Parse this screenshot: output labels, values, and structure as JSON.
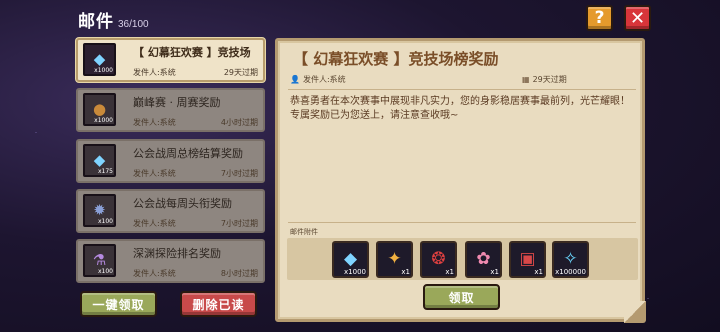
{
  "header": {
    "title": "邮件",
    "count": "36/100",
    "help_label": "?",
    "close_label": "✕"
  },
  "mail_list": [
    {
      "subject": "【 幻幕狂欢赛 】竞技场",
      "sender": "发件人:系统",
      "expire": "29天过期",
      "icon": "diamond",
      "qty": "x1000",
      "glyph": "◆",
      "color": "#7fd4ff"
    },
    {
      "subject": "巅峰赛 · 周赛奖励",
      "sender": "发件人:系统",
      "expire": "4小时过期",
      "icon": "medal",
      "qty": "x1000",
      "glyph": "●",
      "color": "#c98a3a"
    },
    {
      "subject": "公会战周总榜结算奖励",
      "sender": "发件人:系统",
      "expire": "7小时过期",
      "icon": "diamond",
      "qty": "x175",
      "glyph": "◆",
      "color": "#7fd4ff"
    },
    {
      "subject": "公会战每周头衔奖励",
      "sender": "发件人:系统",
      "expire": "7小时过期",
      "icon": "gear-badge",
      "qty": "x100",
      "glyph": "✹",
      "color": "#8aa0d8"
    },
    {
      "subject": "深渊探险排名奖励",
      "sender": "发件人:系统",
      "expire": "8小时过期",
      "icon": "potion",
      "qty": "x100",
      "glyph": "⚗",
      "color": "#b58ae0"
    }
  ],
  "buttons": {
    "claim_all": "一键领取",
    "delete_read": "删除已读",
    "claim": "领取"
  },
  "detail": {
    "title": "【 幻幕狂欢赛 】竞技场榜奖励",
    "sender": "发件人:系统",
    "expire": "29天过期",
    "body": "恭喜勇者在本次赛事中展现非凡实力，您的身影稳居赛事最前列，光芒耀眼！专属奖励已为您送上，请注意查收哦~",
    "attach_label": "邮件附件",
    "attachments": [
      {
        "icon": "diamond",
        "qty": "x1000",
        "glyph": "◆",
        "color": "#7fd4ff"
      },
      {
        "icon": "hero-portrait",
        "qty": "x1",
        "glyph": "✦",
        "color": "#f0b040"
      },
      {
        "icon": "dark-mage-portrait",
        "qty": "x1",
        "glyph": "❂",
        "color": "#e04040"
      },
      {
        "icon": "pink-hero-portrait",
        "qty": "x1",
        "glyph": "✿",
        "color": "#f08ab0"
      },
      {
        "icon": "chest",
        "qty": "x1",
        "glyph": "▣",
        "color": "#d84848"
      },
      {
        "icon": "gem-pile",
        "qty": "x100000",
        "glyph": "✧",
        "color": "#6ad8ff"
      }
    ]
  },
  "colors": {
    "accent_green": "#9aa85a",
    "accent_red": "#c84a4a",
    "help_orange": "#e59a2c",
    "close_red": "#d8353a"
  }
}
